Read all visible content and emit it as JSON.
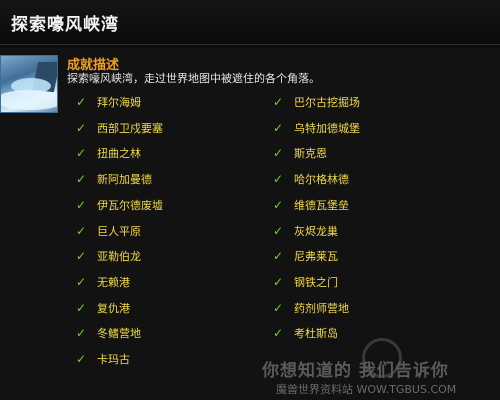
{
  "window": {
    "title": "探索嚎风峡湾"
  },
  "achievement": {
    "heading": "成就描述",
    "description": "探索嚎风峡湾，走过世界地图中被遮住的各个角落。",
    "check_glyph": "✓",
    "left_column": [
      "拜尔海姆",
      "西部卫戍要塞",
      "扭曲之林",
      "新阿加曼德",
      "伊瓦尔德废墟",
      "巨人平原",
      "亚勒伯龙",
      "无赖港",
      "复仇港",
      "冬鳍营地",
      "卡玛古"
    ],
    "right_column": [
      "巴尔古挖掘场",
      "乌特加德城堡",
      "斯克恩",
      "哈尔格林德",
      "维德瓦堡垒",
      "灰烬龙巢",
      "尼弗莱瓦",
      "钢铁之门",
      "药剂师营地",
      "考杜斯岛"
    ]
  },
  "watermark": {
    "line1": "你想知道的 我们告诉你",
    "line2": "魔兽世界资料站 WOW.TGBUS.COM"
  },
  "colors": {
    "heading": "#f0a020",
    "criteria": "#f2d94a",
    "check": "#6fd52d",
    "background": "#0e0e0e"
  }
}
